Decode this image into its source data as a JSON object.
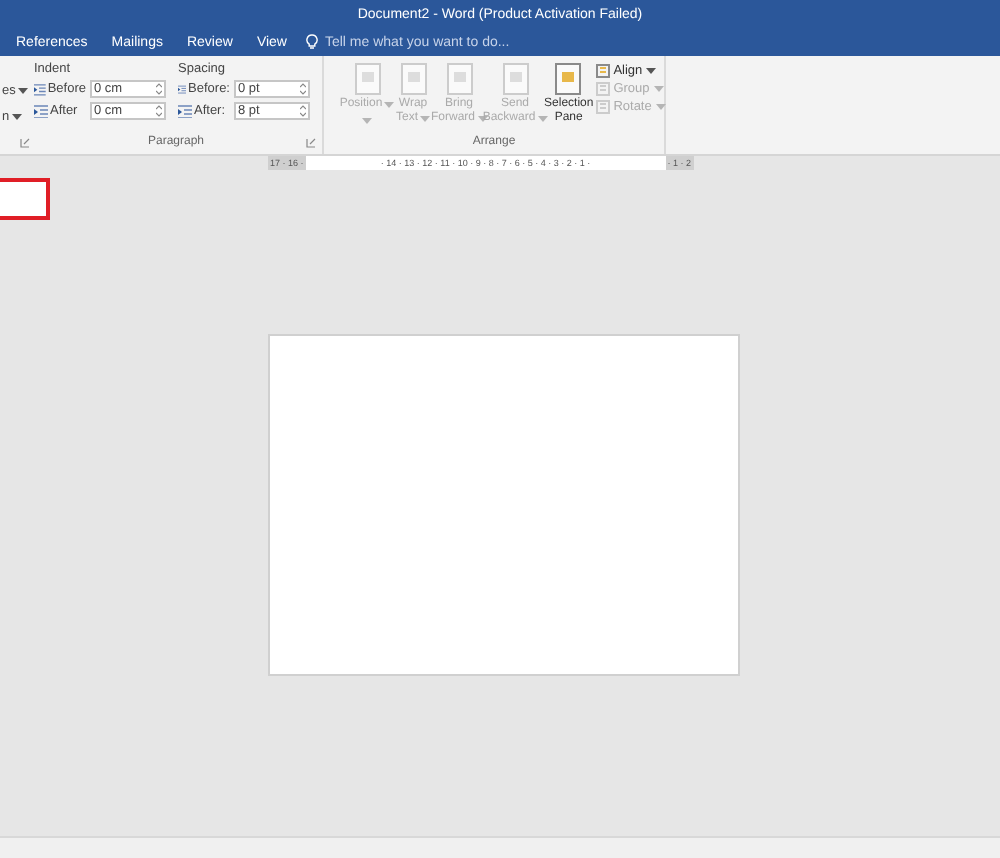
{
  "window": {
    "title": "Document2 - Word (Product Activation Failed)"
  },
  "tabs": [
    {
      "label": "References"
    },
    {
      "label": "Mailings"
    },
    {
      "label": "Review"
    },
    {
      "label": "View"
    }
  ],
  "tell_me": {
    "placeholder": "Tell me what you want to do..."
  },
  "cut_column": [
    {
      "label": "es",
      "dropdown": true
    },
    {
      "label": "n",
      "dropdown": true
    }
  ],
  "paragraph": {
    "label": "Paragraph",
    "sections": [
      {
        "title": "Indent",
        "fields": [
          {
            "label": "Before",
            "value": "0 cm"
          },
          {
            "label": "After",
            "value": "0 cm"
          }
        ]
      },
      {
        "title": "Spacing",
        "fields": [
          {
            "label": "Before:",
            "value": "0 pt"
          },
          {
            "label": "After:",
            "value": "8 pt"
          }
        ]
      }
    ]
  },
  "arrange": {
    "label": "Arrange",
    "buttons": [
      {
        "lines": [
          "Position"
        ],
        "disabled": true,
        "dropdown": true
      },
      {
        "lines": [
          "Wrap",
          "Text"
        ],
        "disabled": true,
        "dropdown": true
      },
      {
        "lines": [
          "Bring",
          "Forward"
        ],
        "disabled": true,
        "dropdown": true
      },
      {
        "lines": [
          "Send",
          "Backward"
        ],
        "disabled": true,
        "dropdown": true
      },
      {
        "lines": [
          "Selection",
          "Pane"
        ],
        "disabled": false,
        "dropdown": false
      }
    ],
    "small_buttons": [
      {
        "label": "Align",
        "disabled": false,
        "dropdown": true
      },
      {
        "label": "Group",
        "disabled": true,
        "dropdown": true
      },
      {
        "label": "Rotate",
        "disabled": true,
        "dropdown": true
      }
    ]
  },
  "ruler": {
    "left_margin": "17 · 16 ·",
    "body": "· 14 · 13 · 12 · 11 · 10 · 9 · 8 · 7 · 6 · 5 · 4 · 3 · 2 · 1 ·",
    "right_margin": "· 1 · 2"
  }
}
